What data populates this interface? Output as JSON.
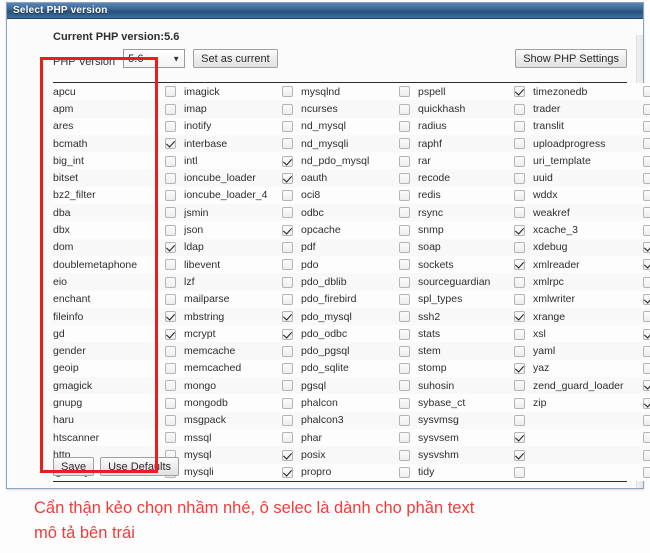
{
  "window": {
    "title": "Select PHP version"
  },
  "header": {
    "current_label": "Current PHP version:",
    "current_value": "5.6",
    "php_version_label": "PHP Version",
    "selected_version": "5.6",
    "version_options": [
      "5.6"
    ],
    "dropdown_arrow": "▼",
    "set_as_current_label": "Set as current",
    "show_php_settings_label": "Show PHP Settings"
  },
  "footer": {
    "save_label": "Save",
    "use_defaults_label": "Use Defaults"
  },
  "caption": {
    "line1": "Cẩn thận kẻo chọn nhầm nhé, ô selec là dành cho phần text",
    "line2": "mô tả bên trái"
  },
  "colors": {
    "titlebar": "#37628f",
    "accent_value": "#e8701a",
    "highlight_box": "#ee1c1c",
    "caption_text": "#f23b3b"
  },
  "extensions": {
    "columns": 5,
    "rows": [
      {
        "c": [
          {
            "n": "apcu",
            "v": false
          },
          {
            "n": "imagick",
            "v": false
          },
          {
            "n": "mysqlnd",
            "v": false
          },
          {
            "n": "pspell",
            "v": true
          },
          {
            "n": "timezonedb",
            "v": false
          }
        ]
      },
      {
        "c": [
          {
            "n": "apm",
            "v": false
          },
          {
            "n": "imap",
            "v": false
          },
          {
            "n": "ncurses",
            "v": false
          },
          {
            "n": "quickhash",
            "v": false
          },
          {
            "n": "trader",
            "v": false
          }
        ]
      },
      {
        "c": [
          {
            "n": "ares",
            "v": false
          },
          {
            "n": "inotify",
            "v": false
          },
          {
            "n": "nd_mysql",
            "v": false
          },
          {
            "n": "radius",
            "v": false
          },
          {
            "n": "translit",
            "v": false
          }
        ]
      },
      {
        "c": [
          {
            "n": "bcmath",
            "v": true
          },
          {
            "n": "interbase",
            "v": false
          },
          {
            "n": "nd_mysqli",
            "v": false
          },
          {
            "n": "raphf",
            "v": false
          },
          {
            "n": "uploadprogress",
            "v": false
          }
        ]
      },
      {
        "c": [
          {
            "n": "big_int",
            "v": false
          },
          {
            "n": "intl",
            "v": true
          },
          {
            "n": "nd_pdo_mysql",
            "v": false
          },
          {
            "n": "rar",
            "v": false
          },
          {
            "n": "uri_template",
            "v": false
          }
        ]
      },
      {
        "c": [
          {
            "n": "bitset",
            "v": false
          },
          {
            "n": "ioncube_loader",
            "v": true
          },
          {
            "n": "oauth",
            "v": false
          },
          {
            "n": "recode",
            "v": false
          },
          {
            "n": "uuid",
            "v": false
          }
        ]
      },
      {
        "c": [
          {
            "n": "bz2_filter",
            "v": false
          },
          {
            "n": "ioncube_loader_4",
            "v": false
          },
          {
            "n": "oci8",
            "v": false
          },
          {
            "n": "redis",
            "v": false
          },
          {
            "n": "wddx",
            "v": false
          }
        ]
      },
      {
        "c": [
          {
            "n": "dba",
            "v": false
          },
          {
            "n": "jsmin",
            "v": false
          },
          {
            "n": "odbc",
            "v": false
          },
          {
            "n": "rsync",
            "v": false
          },
          {
            "n": "weakref",
            "v": false
          }
        ]
      },
      {
        "c": [
          {
            "n": "dbx",
            "v": false
          },
          {
            "n": "json",
            "v": true
          },
          {
            "n": "opcache",
            "v": false
          },
          {
            "n": "snmp",
            "v": true
          },
          {
            "n": "xcache_3",
            "v": false
          }
        ]
      },
      {
        "c": [
          {
            "n": "dom",
            "v": true
          },
          {
            "n": "ldap",
            "v": false
          },
          {
            "n": "pdf",
            "v": false
          },
          {
            "n": "soap",
            "v": false
          },
          {
            "n": "xdebug",
            "v": true
          }
        ]
      },
      {
        "c": [
          {
            "n": "doublemetaphone",
            "v": false
          },
          {
            "n": "libevent",
            "v": false
          },
          {
            "n": "pdo",
            "v": false
          },
          {
            "n": "sockets",
            "v": true
          },
          {
            "n": "xmlreader",
            "v": true
          }
        ]
      },
      {
        "c": [
          {
            "n": "eio",
            "v": false
          },
          {
            "n": "lzf",
            "v": false
          },
          {
            "n": "pdo_dblib",
            "v": false
          },
          {
            "n": "sourceguardian",
            "v": false
          },
          {
            "n": "xmlrpc",
            "v": false
          }
        ]
      },
      {
        "c": [
          {
            "n": "enchant",
            "v": false
          },
          {
            "n": "mailparse",
            "v": false
          },
          {
            "n": "pdo_firebird",
            "v": false
          },
          {
            "n": "spl_types",
            "v": false
          },
          {
            "n": "xmlwriter",
            "v": true
          }
        ]
      },
      {
        "c": [
          {
            "n": "fileinfo",
            "v": true
          },
          {
            "n": "mbstring",
            "v": true
          },
          {
            "n": "pdo_mysql",
            "v": false
          },
          {
            "n": "ssh2",
            "v": true
          },
          {
            "n": "xrange",
            "v": false
          }
        ]
      },
      {
        "c": [
          {
            "n": "gd",
            "v": true
          },
          {
            "n": "mcrypt",
            "v": true
          },
          {
            "n": "pdo_odbc",
            "v": false
          },
          {
            "n": "stats",
            "v": false
          },
          {
            "n": "xsl",
            "v": true
          }
        ]
      },
      {
        "c": [
          {
            "n": "gender",
            "v": false
          },
          {
            "n": "memcache",
            "v": false
          },
          {
            "n": "pdo_pgsql",
            "v": false
          },
          {
            "n": "stem",
            "v": false
          },
          {
            "n": "yaml",
            "v": false
          }
        ]
      },
      {
        "c": [
          {
            "n": "geoip",
            "v": false
          },
          {
            "n": "memcached",
            "v": false
          },
          {
            "n": "pdo_sqlite",
            "v": false
          },
          {
            "n": "stomp",
            "v": true
          },
          {
            "n": "yaz",
            "v": false
          }
        ]
      },
      {
        "c": [
          {
            "n": "gmagick",
            "v": false
          },
          {
            "n": "mongo",
            "v": false
          },
          {
            "n": "pgsql",
            "v": false
          },
          {
            "n": "suhosin",
            "v": false
          },
          {
            "n": "zend_guard_loader",
            "v": true
          }
        ]
      },
      {
        "c": [
          {
            "n": "gnupg",
            "v": false
          },
          {
            "n": "mongodb",
            "v": false
          },
          {
            "n": "phalcon",
            "v": false
          },
          {
            "n": "sybase_ct",
            "v": false
          },
          {
            "n": "zip",
            "v": true
          }
        ]
      },
      {
        "c": [
          {
            "n": "haru",
            "v": false
          },
          {
            "n": "msgpack",
            "v": false
          },
          {
            "n": "phalcon3",
            "v": false
          },
          {
            "n": "sysvmsg",
            "v": false
          },
          {
            "n": "",
            "v": false
          }
        ]
      },
      {
        "c": [
          {
            "n": "htscanner",
            "v": false
          },
          {
            "n": "mssql",
            "v": false
          },
          {
            "n": "phar",
            "v": false
          },
          {
            "n": "sysvsem",
            "v": true
          },
          {
            "n": "",
            "v": false
          }
        ]
      },
      {
        "c": [
          {
            "n": "http",
            "v": false
          },
          {
            "n": "mysql",
            "v": true
          },
          {
            "n": "posix",
            "v": false
          },
          {
            "n": "sysvshm",
            "v": true
          },
          {
            "n": "",
            "v": false
          }
        ]
      },
      {
        "c": [
          {
            "n": "igbinary",
            "v": false
          },
          {
            "n": "mysqli",
            "v": true
          },
          {
            "n": "propro",
            "v": false
          },
          {
            "n": "tidy",
            "v": false
          },
          {
            "n": "",
            "v": false
          }
        ]
      }
    ]
  }
}
